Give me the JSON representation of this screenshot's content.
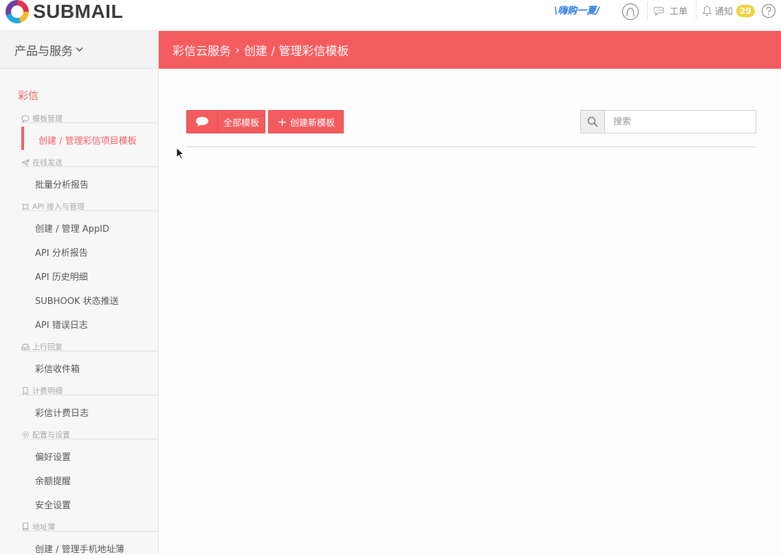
{
  "header": {
    "logo_text": "SUBMAIL",
    "promo_text": "\\嗨购一夏/",
    "ticket_label": "工单",
    "notify_label": "通知",
    "notify_count": "29",
    "help_icon": "question-circle-icon",
    "user_icon": "user-circle-icon"
  },
  "sidebar": {
    "product_menu_label": "产品与服务",
    "section_title": "彩信",
    "groups": [
      {
        "title": "模板管理",
        "icon": "chat-bubble-icon",
        "items": [
          "创建 / 管理彩信项目模板"
        ]
      },
      {
        "title": "在线发送",
        "icon": "paper-plane-icon",
        "items": [
          "批量分析报告"
        ]
      },
      {
        "title": "API 接入与管理",
        "icon": "api-icon",
        "items": [
          "创建 / 管理 AppID",
          "API 分析报告",
          "API 历史明细",
          "SUBHOOK 状态推送",
          "API 错误日志"
        ]
      },
      {
        "title": "上行回复",
        "icon": "inbox-icon",
        "items": [
          "彩信收件箱"
        ]
      },
      {
        "title": "计费明细",
        "icon": "bookmark-icon",
        "items": [
          "彩信计费日志"
        ]
      },
      {
        "title": "配置与设置",
        "icon": "gear-icon",
        "items": [
          "偏好设置",
          "余额提醒",
          "安全设置"
        ]
      },
      {
        "title": "地址薄",
        "icon": "address-book-icon",
        "items": [
          "创建 / 管理手机地址薄"
        ]
      }
    ]
  },
  "breadcrumb": {
    "parent": "彩信云服务",
    "separator": "›",
    "current": "创建 / 管理彩信模板"
  },
  "toolbar": {
    "all_templates_label": "全部模板",
    "create_label": "创建新模板",
    "search_placeholder": "搜索"
  },
  "colors": {
    "accent": "#f45b5f",
    "badge": "#f3d244",
    "promo": "#2e7be0"
  }
}
